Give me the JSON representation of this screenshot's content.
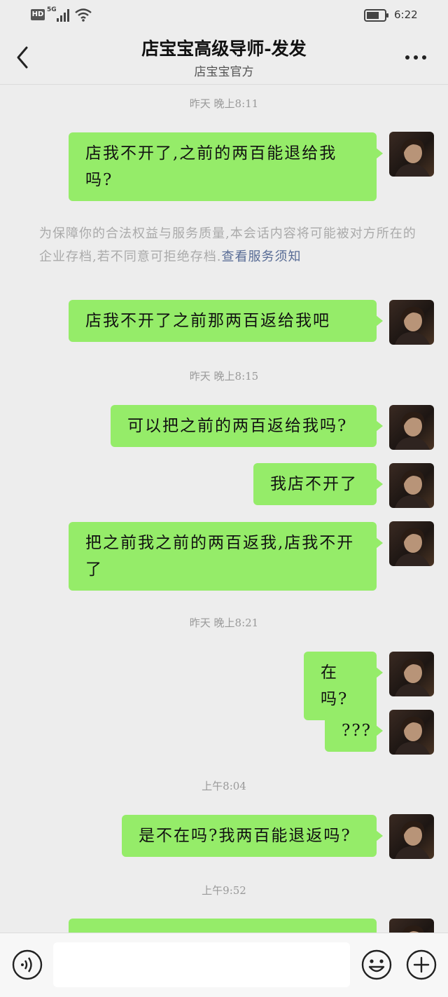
{
  "status_bar": {
    "hd_badge": "HD",
    "network": "5G",
    "time": "6:22"
  },
  "header": {
    "title": "店宝宝高级导师-发发",
    "subtitle": "店宝宝官方"
  },
  "messages": [
    {
      "time": "昨天 晚上8:11"
    },
    {
      "text": "店我不开了,之前的两百能退给我吗?"
    },
    {
      "notice": "为保障你的合法权益与服务质量,本会话内容将可能被对方所在的企业存档,若不同意可拒绝存档.",
      "link": "查看服务须知"
    },
    {
      "text": "店我不开了之前那两百返给我吧"
    },
    {
      "time": "昨天 晚上8:15"
    },
    {
      "text": "可以把之前的两百返给我吗?"
    },
    {
      "text": "我店不开了"
    },
    {
      "text": "把之前我之前的两百返我,店我不开了"
    },
    {
      "time": "昨天 晚上8:21"
    },
    {
      "text": "在吗?"
    },
    {
      "text": "???"
    },
    {
      "time": "上午8:04"
    },
    {
      "text": "是不在吗?我两百能退返吗?"
    },
    {
      "time": "上午9:52"
    },
    {
      "text": ""
    }
  ],
  "input_bar": {
    "placeholder": ""
  },
  "colors": {
    "background": "#ededed",
    "bubble": "#95ec69",
    "link": "#576b95",
    "time_text": "#999999"
  },
  "icons": {
    "back": "chevron-left-icon",
    "more": "more-dots-icon",
    "voice": "voice-icon",
    "emoji": "emoji-icon",
    "plus": "plus-icon"
  }
}
